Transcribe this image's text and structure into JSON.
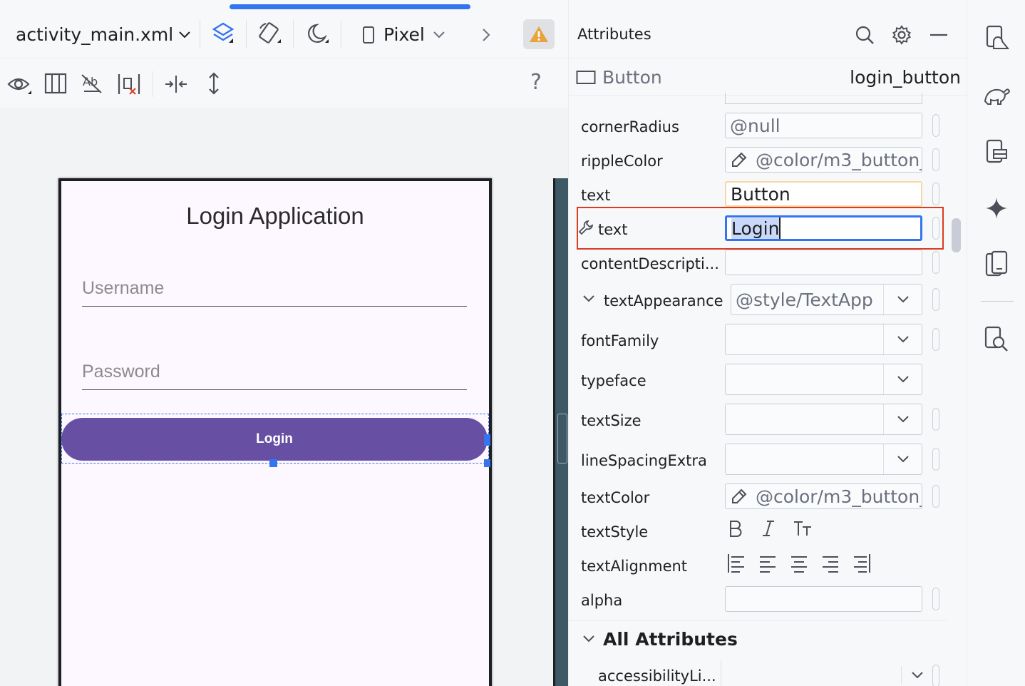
{
  "editor": {
    "filename": "activity_main.xml",
    "device": "Pixel",
    "help": "?"
  },
  "preview": {
    "title": "Login Application",
    "username_hint": "Username",
    "password_hint": "Password",
    "button_text": "Login"
  },
  "attributes": {
    "panel_title": "Attributes",
    "component_type": "Button",
    "component_id": "login_button",
    "rows": [
      {
        "label": "cornerRadius",
        "value": "@null"
      },
      {
        "label": "rippleColor",
        "value": "@color/m3_button_"
      },
      {
        "label": "text",
        "value": "Button"
      },
      {
        "label": "text",
        "value": "Login"
      },
      {
        "label": "contentDescripti...",
        "value": ""
      },
      {
        "label": "textAppearance",
        "value": "@style/TextApp"
      },
      {
        "label": "fontFamily",
        "value": ""
      },
      {
        "label": "typeface",
        "value": ""
      },
      {
        "label": "textSize",
        "value": ""
      },
      {
        "label": "lineSpacingExtra",
        "value": ""
      },
      {
        "label": "textColor",
        "value": "@color/m3_button_"
      },
      {
        "label": "textStyle",
        "value": ""
      },
      {
        "label": "textAlignment",
        "value": ""
      },
      {
        "label": "alpha",
        "value": ""
      }
    ],
    "all_attributes": "All Attributes",
    "first_all_attr": "accessibilityLi..."
  },
  "colors": {
    "accent": "#3574f0",
    "button": "#6750a4",
    "highlight": "#db3b21",
    "warning": "#e8a33d"
  }
}
